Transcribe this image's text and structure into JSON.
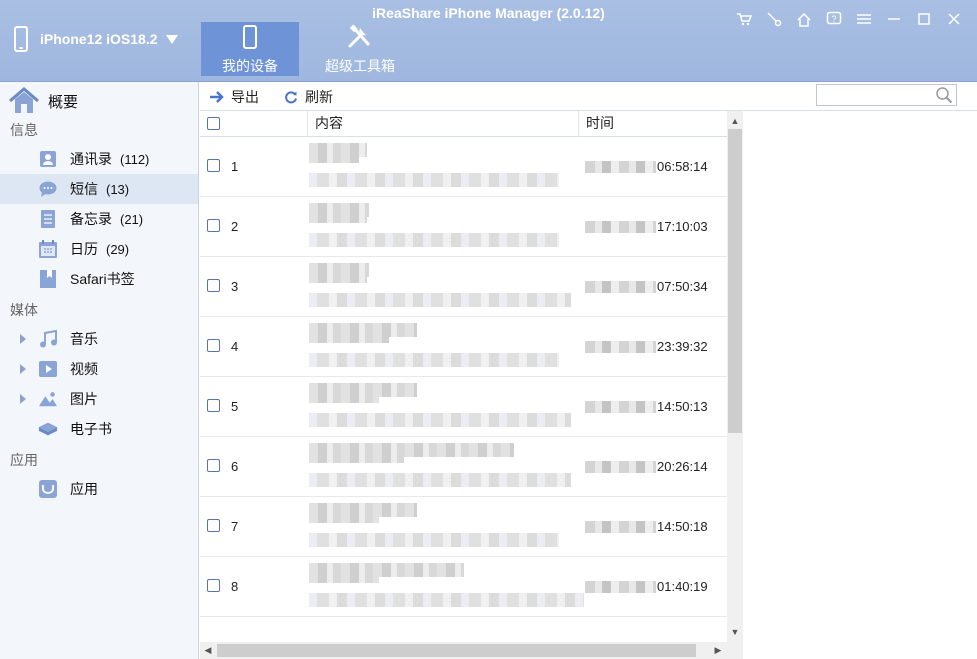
{
  "app": {
    "title": "iReaShare iPhone Manager (2.0.12)"
  },
  "device": {
    "name": "iPhone12 iOS18.2"
  },
  "tabs": [
    {
      "label": "我的设备",
      "icon": "phone-icon",
      "active": true
    },
    {
      "label": "超级工具箱",
      "icon": "tools-icon",
      "active": false
    }
  ],
  "window_buttons": [
    "cart-icon",
    "key-icon",
    "home-icon",
    "help-icon",
    "menu-icon",
    "minimize-icon",
    "maximize-icon",
    "close-icon"
  ],
  "sidebar": {
    "overview": "概要",
    "groups": {
      "info": "信息",
      "media": "媒体",
      "apps": "应用"
    },
    "items": [
      {
        "label": "通讯录",
        "count": "(112)",
        "icon": "contacts-icon"
      },
      {
        "label": "短信",
        "count": "(13)",
        "icon": "messages-icon",
        "selected": true
      },
      {
        "label": "备忘录",
        "count": "(21)",
        "icon": "notes-icon"
      },
      {
        "label": "日历",
        "count": "(29)",
        "icon": "calendar-icon"
      },
      {
        "label": "Safari书签",
        "count": "",
        "icon": "bookmark-icon"
      },
      {
        "label": "音乐",
        "count": "",
        "icon": "music-icon"
      },
      {
        "label": "视频",
        "count": "",
        "icon": "video-icon"
      },
      {
        "label": "图片",
        "count": "",
        "icon": "photo-icon"
      },
      {
        "label": "电子书",
        "count": "",
        "icon": "ebook-icon"
      },
      {
        "label": "应用",
        "count": "",
        "icon": "app-icon"
      }
    ]
  },
  "toolbar": {
    "export_label": "导出",
    "refresh_label": "刷新",
    "search_placeholder": ""
  },
  "table": {
    "columns": {
      "content": "内容",
      "time": "时间"
    },
    "rows": [
      {
        "num": "1",
        "time": "06:58:14"
      },
      {
        "num": "2",
        "time": "17:10:03"
      },
      {
        "num": "3",
        "time": "07:50:34"
      },
      {
        "num": "4",
        "time": "23:39:32"
      },
      {
        "num": "5",
        "time": "14:50:13"
      },
      {
        "num": "6",
        "time": "20:26:14"
      },
      {
        "num": "7",
        "time": "14:50:18"
      },
      {
        "num": "8",
        "time": "01:40:19"
      }
    ]
  },
  "colors": {
    "header_bg": "#a9bfe3",
    "active_tab": "#6f93d7",
    "selected_row": "#dde6f3",
    "sidebar_bg": "#f3f6fb"
  }
}
